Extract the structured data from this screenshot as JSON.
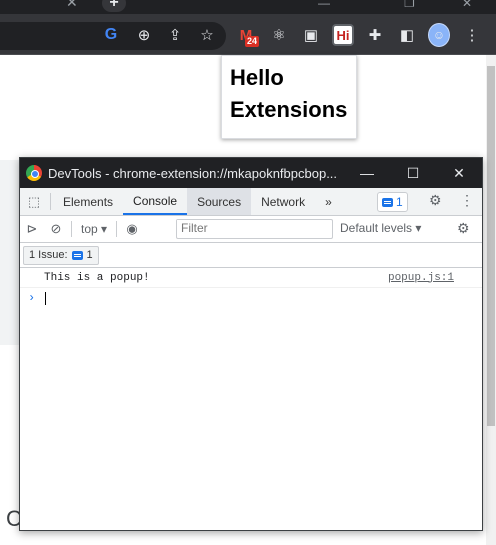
{
  "browser": {
    "toolbar_icons": [
      "google-icon",
      "zoom-icon",
      "share-icon",
      "bookmark-star-icon",
      "gmail-extension-icon",
      "react-devtools-icon",
      "extension-icon",
      "hi-extension-icon",
      "puzzle-icon",
      "sidepanel-icon",
      "profile-avatar-icon",
      "menu-icon"
    ],
    "badge_count": "24",
    "hi_label": "Hi"
  },
  "popup": {
    "heading_line1": "Hello",
    "heading_line2": "Extensions"
  },
  "devtools": {
    "window_title": "DevTools - chrome-extension://mkapoknfbpcbop...",
    "tabs": [
      "Elements",
      "Console",
      "Sources",
      "Network"
    ],
    "selected_tab": "Console",
    "more_tabs": "»",
    "issues_badge": "1",
    "console_toolbar": {
      "context": "top",
      "filter_placeholder": "Filter",
      "levels": "Default levels"
    },
    "issues_bar": {
      "label": "1 Issue:",
      "count": "1"
    },
    "log": [
      {
        "message": "This is a popup!",
        "source": "popup.js:1"
      }
    ],
    "prompt_symbol": "›"
  },
  "colors": {
    "accent": "#1a73e8",
    "frame_dark": "#202124",
    "toolbar": "#35363a"
  }
}
